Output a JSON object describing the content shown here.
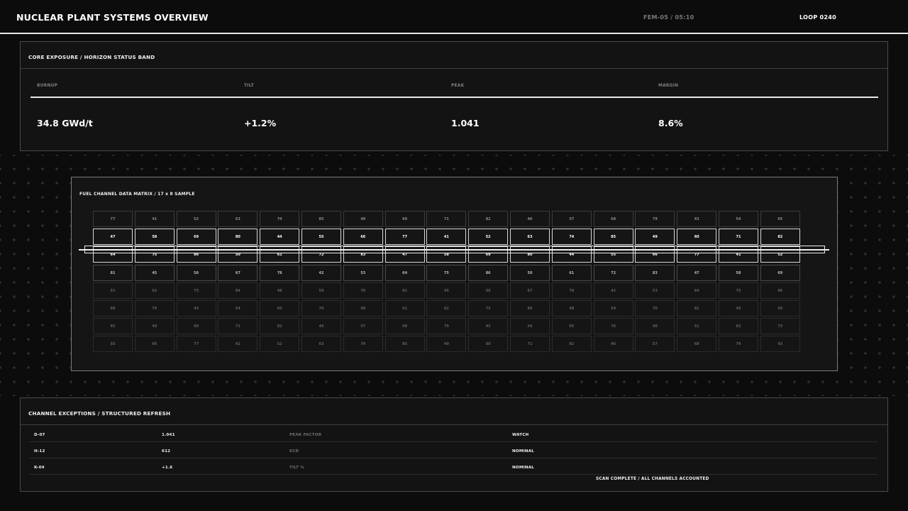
{
  "header": {
    "title": "NUCLEAR PLANT SYSTEMS OVERVIEW",
    "meta": "FEM-05 / 05:10",
    "loop": "LOOP 0240"
  },
  "core_band": {
    "title": "CORE EXPOSURE / HORIZON STATUS BAND",
    "metrics": [
      {
        "label": "BURNUP",
        "value": "34.8 GWd/t"
      },
      {
        "label": "TILT",
        "value": "+1.2%"
      },
      {
        "label": "PEAK",
        "value": "1.041"
      },
      {
        "label": "MARGIN",
        "value": "8.6%"
      }
    ]
  },
  "matrix": {
    "title": "FUEL CHANNEL DATA MATRIX / 17 x 8 SAMPLE",
    "rows": [
      [
        "77",
        "41",
        "52",
        "63",
        "74",
        "85",
        "49",
        "60",
        "71",
        "82",
        "46",
        "57",
        "68",
        "79",
        "43",
        "54",
        "65"
      ],
      [
        "47",
        "58",
        "69",
        "80",
        "44",
        "55",
        "66",
        "77",
        "41",
        "52",
        "63",
        "74",
        "85",
        "49",
        "60",
        "71",
        "82"
      ],
      [
        "64",
        "75",
        "86",
        "50",
        "61",
        "72",
        "83",
        "47",
        "58",
        "69",
        "80",
        "44",
        "55",
        "66",
        "77",
        "41",
        "52"
      ],
      [
        "81",
        "45",
        "56",
        "67",
        "78",
        "42",
        "53",
        "64",
        "75",
        "86",
        "50",
        "61",
        "72",
        "83",
        "47",
        "58",
        "69"
      ],
      [
        "51",
        "62",
        "73",
        "84",
        "48",
        "59",
        "70",
        "81",
        "45",
        "56",
        "67",
        "78",
        "42",
        "53",
        "64",
        "75",
        "86"
      ],
      [
        "68",
        "79",
        "43",
        "54",
        "65",
        "76",
        "40",
        "51",
        "62",
        "73",
        "84",
        "48",
        "59",
        "70",
        "81",
        "45",
        "56"
      ],
      [
        "85",
        "49",
        "60",
        "71",
        "82",
        "46",
        "57",
        "68",
        "79",
        "43",
        "54",
        "65",
        "76",
        "40",
        "51",
        "62",
        "73"
      ],
      [
        "55",
        "66",
        "77",
        "41",
        "52",
        "63",
        "74",
        "85",
        "49",
        "60",
        "71",
        "82",
        "46",
        "57",
        "68",
        "79",
        "43"
      ]
    ]
  },
  "exceptions": {
    "title": "CHANNEL EXCEPTIONS / STRUCTURED REFRESH",
    "rows": [
      {
        "channel": "D-07",
        "value": "1.041",
        "metric": "PEAK FACTOR",
        "status": "WATCH"
      },
      {
        "channel": "H-12",
        "value": "612",
        "metric": "ECD",
        "status": "NOMINAL"
      },
      {
        "channel": "K-04",
        "value": "+1.6",
        "metric": "TILT %",
        "status": "NOMINAL"
      }
    ],
    "footer": "SCAN COMPLETE / ALL CHANNELS ACCOUNTED"
  }
}
